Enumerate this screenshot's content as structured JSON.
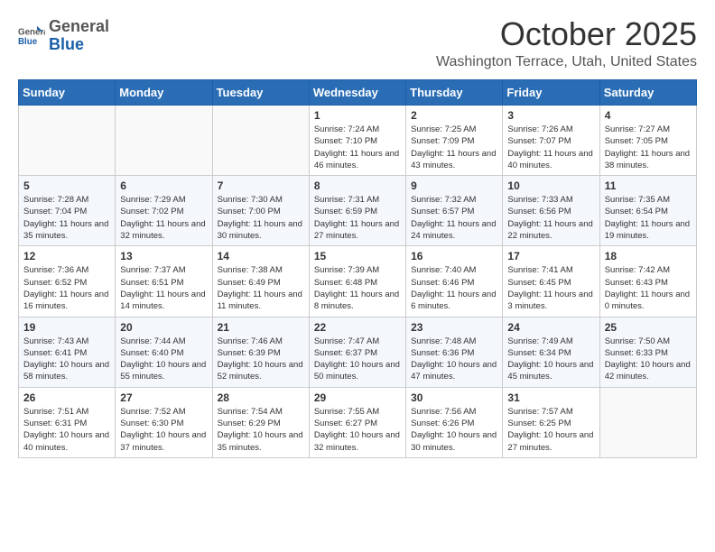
{
  "header": {
    "logo_general": "General",
    "logo_blue": "Blue",
    "month": "October 2025",
    "location": "Washington Terrace, Utah, United States"
  },
  "days_of_week": [
    "Sunday",
    "Monday",
    "Tuesday",
    "Wednesday",
    "Thursday",
    "Friday",
    "Saturday"
  ],
  "weeks": [
    [
      {
        "day": "",
        "info": ""
      },
      {
        "day": "",
        "info": ""
      },
      {
        "day": "",
        "info": ""
      },
      {
        "day": "1",
        "info": "Sunrise: 7:24 AM\nSunset: 7:10 PM\nDaylight: 11 hours and 46 minutes."
      },
      {
        "day": "2",
        "info": "Sunrise: 7:25 AM\nSunset: 7:09 PM\nDaylight: 11 hours and 43 minutes."
      },
      {
        "day": "3",
        "info": "Sunrise: 7:26 AM\nSunset: 7:07 PM\nDaylight: 11 hours and 40 minutes."
      },
      {
        "day": "4",
        "info": "Sunrise: 7:27 AM\nSunset: 7:05 PM\nDaylight: 11 hours and 38 minutes."
      }
    ],
    [
      {
        "day": "5",
        "info": "Sunrise: 7:28 AM\nSunset: 7:04 PM\nDaylight: 11 hours and 35 minutes."
      },
      {
        "day": "6",
        "info": "Sunrise: 7:29 AM\nSunset: 7:02 PM\nDaylight: 11 hours and 32 minutes."
      },
      {
        "day": "7",
        "info": "Sunrise: 7:30 AM\nSunset: 7:00 PM\nDaylight: 11 hours and 30 minutes."
      },
      {
        "day": "8",
        "info": "Sunrise: 7:31 AM\nSunset: 6:59 PM\nDaylight: 11 hours and 27 minutes."
      },
      {
        "day": "9",
        "info": "Sunrise: 7:32 AM\nSunset: 6:57 PM\nDaylight: 11 hours and 24 minutes."
      },
      {
        "day": "10",
        "info": "Sunrise: 7:33 AM\nSunset: 6:56 PM\nDaylight: 11 hours and 22 minutes."
      },
      {
        "day": "11",
        "info": "Sunrise: 7:35 AM\nSunset: 6:54 PM\nDaylight: 11 hours and 19 minutes."
      }
    ],
    [
      {
        "day": "12",
        "info": "Sunrise: 7:36 AM\nSunset: 6:52 PM\nDaylight: 11 hours and 16 minutes."
      },
      {
        "day": "13",
        "info": "Sunrise: 7:37 AM\nSunset: 6:51 PM\nDaylight: 11 hours and 14 minutes."
      },
      {
        "day": "14",
        "info": "Sunrise: 7:38 AM\nSunset: 6:49 PM\nDaylight: 11 hours and 11 minutes."
      },
      {
        "day": "15",
        "info": "Sunrise: 7:39 AM\nSunset: 6:48 PM\nDaylight: 11 hours and 8 minutes."
      },
      {
        "day": "16",
        "info": "Sunrise: 7:40 AM\nSunset: 6:46 PM\nDaylight: 11 hours and 6 minutes."
      },
      {
        "day": "17",
        "info": "Sunrise: 7:41 AM\nSunset: 6:45 PM\nDaylight: 11 hours and 3 minutes."
      },
      {
        "day": "18",
        "info": "Sunrise: 7:42 AM\nSunset: 6:43 PM\nDaylight: 11 hours and 0 minutes."
      }
    ],
    [
      {
        "day": "19",
        "info": "Sunrise: 7:43 AM\nSunset: 6:41 PM\nDaylight: 10 hours and 58 minutes."
      },
      {
        "day": "20",
        "info": "Sunrise: 7:44 AM\nSunset: 6:40 PM\nDaylight: 10 hours and 55 minutes."
      },
      {
        "day": "21",
        "info": "Sunrise: 7:46 AM\nSunset: 6:39 PM\nDaylight: 10 hours and 52 minutes."
      },
      {
        "day": "22",
        "info": "Sunrise: 7:47 AM\nSunset: 6:37 PM\nDaylight: 10 hours and 50 minutes."
      },
      {
        "day": "23",
        "info": "Sunrise: 7:48 AM\nSunset: 6:36 PM\nDaylight: 10 hours and 47 minutes."
      },
      {
        "day": "24",
        "info": "Sunrise: 7:49 AM\nSunset: 6:34 PM\nDaylight: 10 hours and 45 minutes."
      },
      {
        "day": "25",
        "info": "Sunrise: 7:50 AM\nSunset: 6:33 PM\nDaylight: 10 hours and 42 minutes."
      }
    ],
    [
      {
        "day": "26",
        "info": "Sunrise: 7:51 AM\nSunset: 6:31 PM\nDaylight: 10 hours and 40 minutes."
      },
      {
        "day": "27",
        "info": "Sunrise: 7:52 AM\nSunset: 6:30 PM\nDaylight: 10 hours and 37 minutes."
      },
      {
        "day": "28",
        "info": "Sunrise: 7:54 AM\nSunset: 6:29 PM\nDaylight: 10 hours and 35 minutes."
      },
      {
        "day": "29",
        "info": "Sunrise: 7:55 AM\nSunset: 6:27 PM\nDaylight: 10 hours and 32 minutes."
      },
      {
        "day": "30",
        "info": "Sunrise: 7:56 AM\nSunset: 6:26 PM\nDaylight: 10 hours and 30 minutes."
      },
      {
        "day": "31",
        "info": "Sunrise: 7:57 AM\nSunset: 6:25 PM\nDaylight: 10 hours and 27 minutes."
      },
      {
        "day": "",
        "info": ""
      }
    ]
  ]
}
